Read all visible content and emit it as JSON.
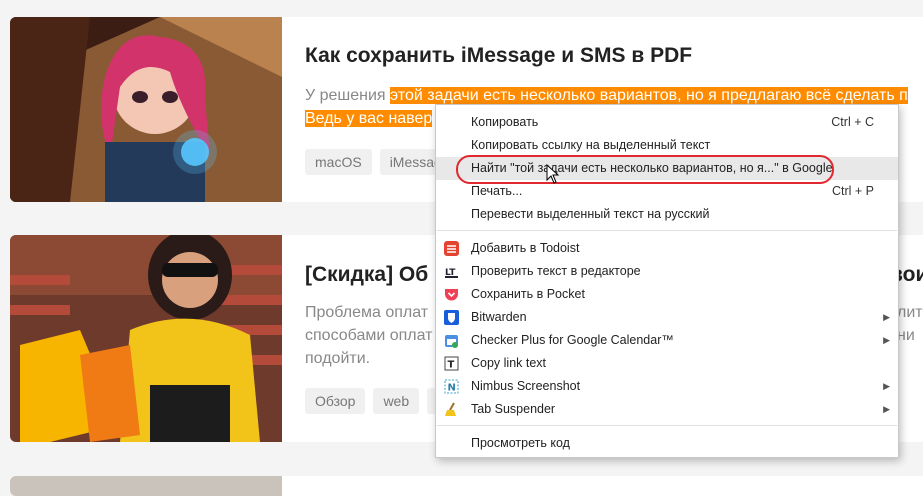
{
  "posts": [
    {
      "title": "Как сохранить iMessage и SMS в PDF",
      "excerpt_start": "У решения ",
      "excerpt_highlight_1": "этой задачи есть несколько вариантов, но я предлагаю всё сделать п",
      "excerpt_highlight_2": "Ведь у вас навер",
      "tags": [
        "macOS",
        "iMessage"
      ]
    },
    {
      "title": "[Скидка] Об",
      "title_tail": "вои",
      "excerpt_1": "Проблема оплат",
      "excerpt_1_tail": "лит",
      "excerpt_2": "способами оплат",
      "excerpt_2_tail": "ни",
      "excerpt_3": "подойти.",
      "tags": [
        "Обзор",
        "web",
        "С"
      ]
    }
  ],
  "context_menu": {
    "items_top": [
      {
        "label": "Копировать",
        "shortcut": "Ctrl + C"
      },
      {
        "label": "Копировать ссылку на выделенный текст",
        "shortcut": ""
      },
      {
        "label": "Найти \"той задачи есть несколько вариантов, но я...\" в Google",
        "shortcut": ""
      },
      {
        "label": "Печать...",
        "shortcut": "Ctrl + P"
      },
      {
        "label": "Перевести выделенный текст на русский",
        "shortcut": ""
      }
    ],
    "extensions": [
      {
        "label": "Добавить в Todoist",
        "icon": "todoist-icon",
        "submenu": false
      },
      {
        "label": "Проверить текст в редакторе",
        "icon": "languagetool-icon",
        "submenu": false
      },
      {
        "label": "Сохранить в Pocket",
        "icon": "pocket-icon",
        "submenu": false
      },
      {
        "label": "Bitwarden",
        "icon": "bitwarden-icon",
        "submenu": true
      },
      {
        "label": "Checker Plus for Google Calendar™",
        "icon": "calendar-icon",
        "submenu": true
      },
      {
        "label": "Copy link text",
        "icon": "copy-link-icon",
        "submenu": false
      },
      {
        "label": "Nimbus Screenshot",
        "icon": "nimbus-icon",
        "submenu": true
      },
      {
        "label": "Tab Suspender",
        "icon": "broom-icon",
        "submenu": true
      }
    ],
    "inspect": "Просмотреть код"
  },
  "colors": {
    "highlight": "#ff8c00",
    "annotation": "#e0282e"
  }
}
